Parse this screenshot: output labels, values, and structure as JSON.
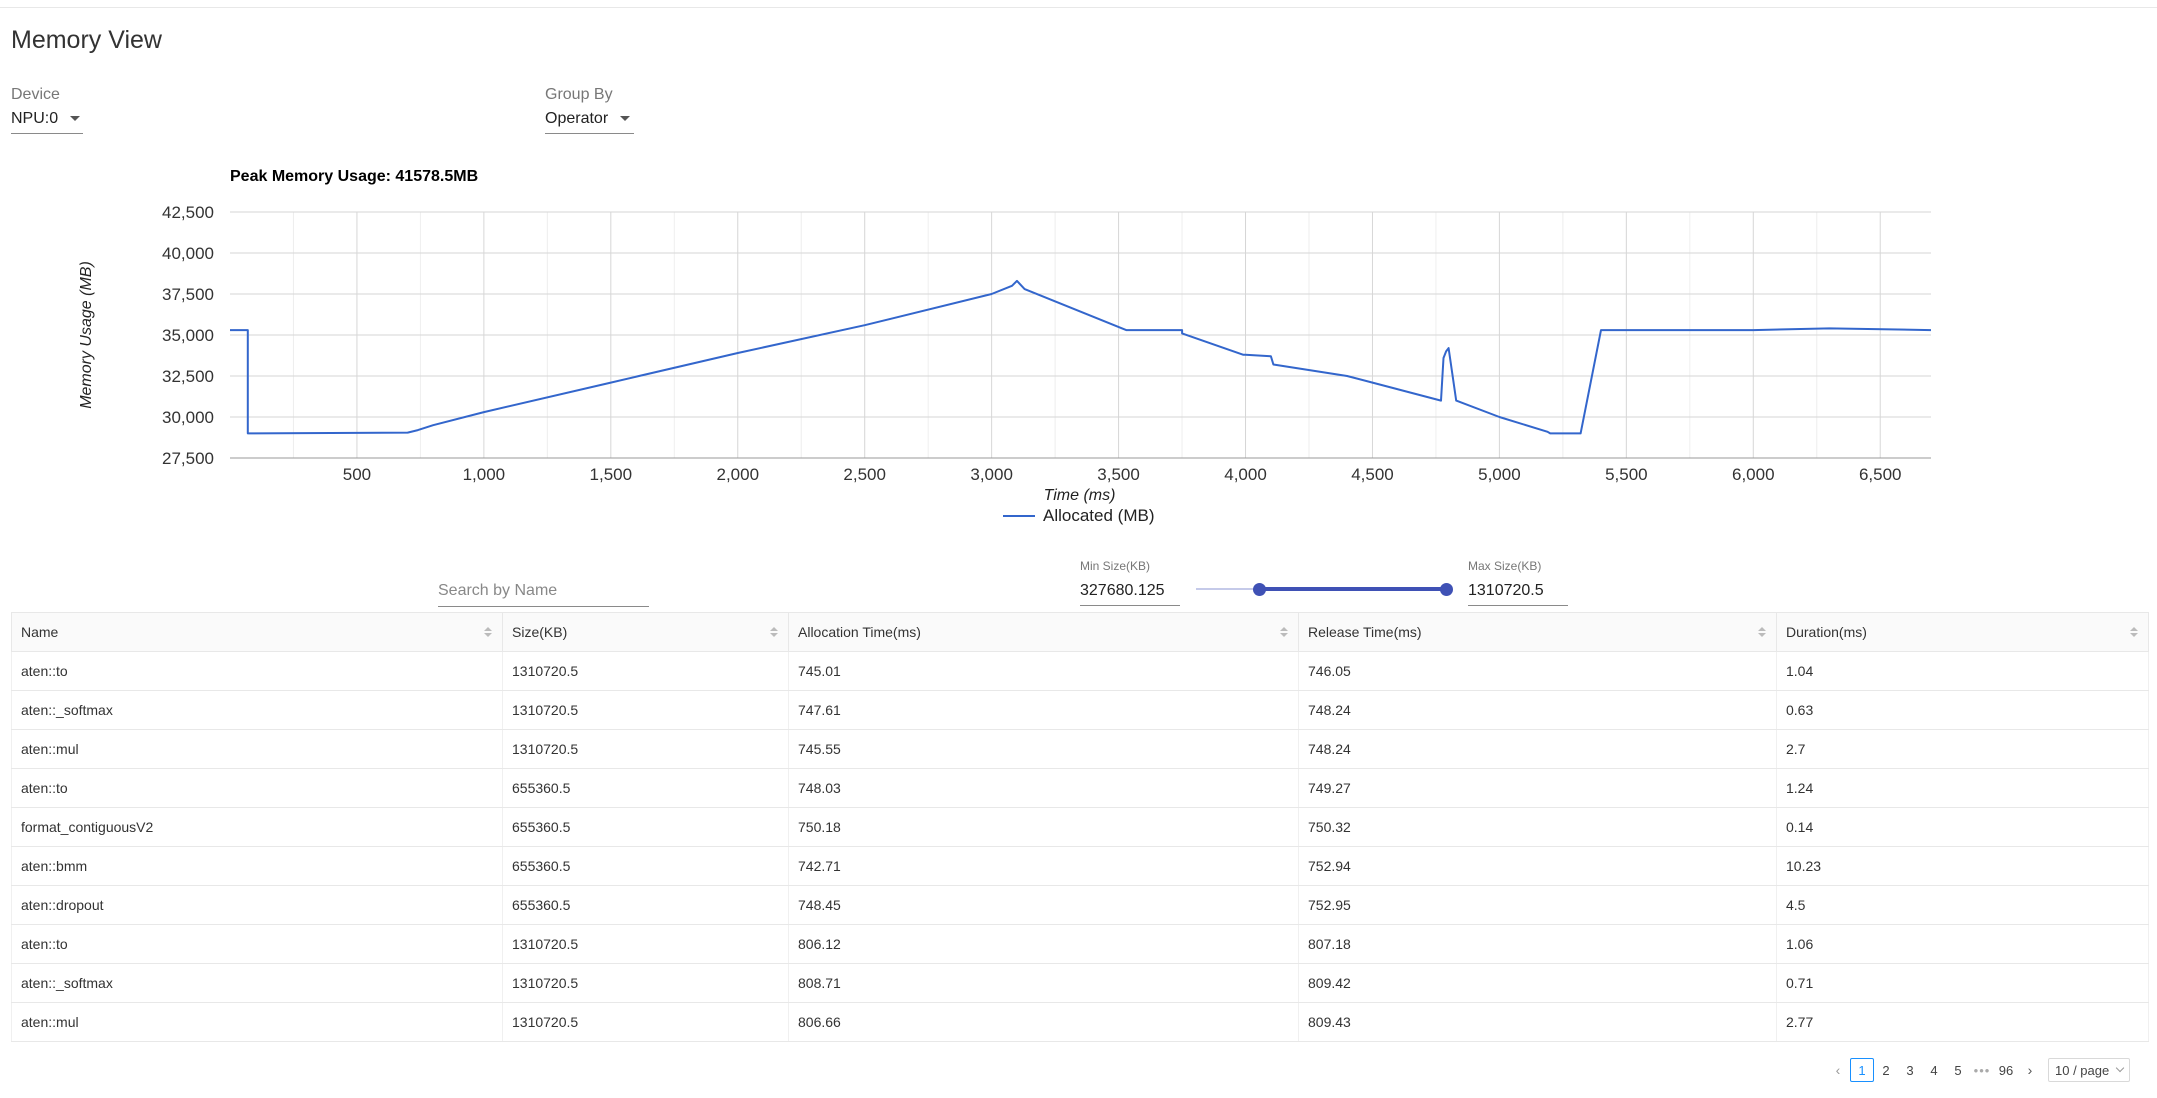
{
  "page": {
    "title": "Memory View"
  },
  "filters": {
    "device": {
      "label": "Device",
      "value": "NPU:0"
    },
    "group_by": {
      "label": "Group By",
      "value": "Operator"
    }
  },
  "chart_data": {
    "type": "line",
    "title": "Peak Memory Usage: 41578.5MB",
    "xlabel": "Time (ms)",
    "ylabel": "Memory Usage (MB)",
    "xlim": [
      0,
      6700
    ],
    "ylim": [
      27500,
      42500
    ],
    "x_ticks": [
      500,
      1000,
      1500,
      2000,
      2500,
      3000,
      3500,
      4000,
      4500,
      5000,
      5500,
      6000,
      6500
    ],
    "y_ticks": [
      27500,
      30000,
      32500,
      35000,
      37500,
      40000,
      42500
    ],
    "grid": true,
    "legend_position": "bottom",
    "series": [
      {
        "name": "Allocated (MB)",
        "color": "#3366cc",
        "x": [
          0,
          70,
          70,
          700,
          740,
          800,
          1000,
          1500,
          2000,
          2500,
          3000,
          3080,
          3100,
          3130,
          3530,
          3750,
          3750,
          3990,
          4000,
          4100,
          4110,
          4400,
          4500,
          4770,
          4780,
          4790,
          4800,
          4830,
          5000,
          5190,
          5200,
          5320,
          5400,
          6000,
          6300,
          6700
        ],
        "y": [
          35300,
          35300,
          29000,
          29050,
          29200,
          29500,
          30300,
          32100,
          33900,
          35600,
          37500,
          38000,
          38300,
          37800,
          35300,
          35300,
          35100,
          33800,
          33800,
          33700,
          33200,
          32500,
          32100,
          31000,
          33600,
          34000,
          34200,
          31000,
          30000,
          29100,
          29000,
          29000,
          35300,
          35300,
          35400,
          35300
        ]
      }
    ]
  },
  "table_filters": {
    "search_placeholder": "Search by Name",
    "min_size_label": "Min Size(KB)",
    "min_size_value": "327680.125",
    "max_size_label": "Max Size(KB)",
    "max_size_value": "1310720.5",
    "slider_min_fraction": 0.25,
    "slider_max_fraction": 1.0
  },
  "table": {
    "columns": [
      "Name",
      "Size(KB)",
      "Allocation Time(ms)",
      "Release Time(ms)",
      "Duration(ms)"
    ],
    "rows": [
      [
        "aten::to",
        "1310720.5",
        "745.01",
        "746.05",
        "1.04"
      ],
      [
        "aten::_softmax",
        "1310720.5",
        "747.61",
        "748.24",
        "0.63"
      ],
      [
        "aten::mul",
        "1310720.5",
        "745.55",
        "748.24",
        "2.7"
      ],
      [
        "aten::to",
        "655360.5",
        "748.03",
        "749.27",
        "1.24"
      ],
      [
        "format_contiguousV2",
        "655360.5",
        "750.18",
        "750.32",
        "0.14"
      ],
      [
        "aten::bmm",
        "655360.5",
        "742.71",
        "752.94",
        "10.23"
      ],
      [
        "aten::dropout",
        "655360.5",
        "748.45",
        "752.95",
        "4.5"
      ],
      [
        "aten::to",
        "1310720.5",
        "806.12",
        "807.18",
        "1.06"
      ],
      [
        "aten::_softmax",
        "1310720.5",
        "808.71",
        "809.42",
        "0.71"
      ],
      [
        "aten::mul",
        "1310720.5",
        "806.66",
        "809.43",
        "2.77"
      ]
    ]
  },
  "pagination": {
    "prev_icon": "chevron-left-icon",
    "next_icon": "chevron-right-icon",
    "pages": [
      "1",
      "2",
      "3",
      "4",
      "5"
    ],
    "ellipsis": "•••",
    "last_page": "96",
    "current_page": "1",
    "page_size": "10 / page"
  }
}
